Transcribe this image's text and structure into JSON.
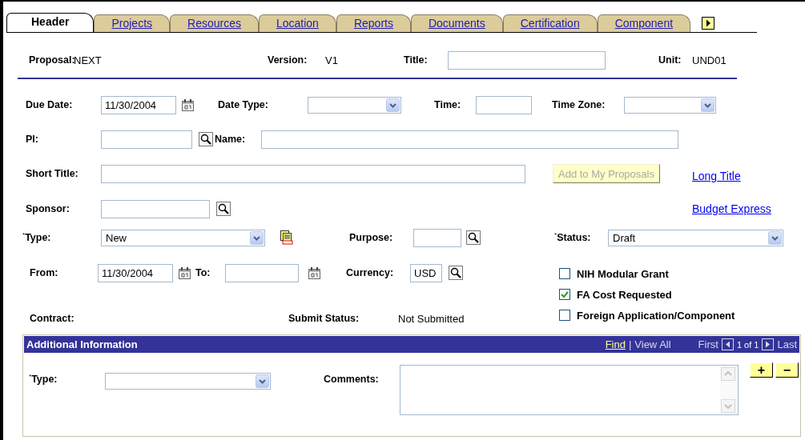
{
  "tabs": [
    {
      "label": "Header",
      "selected": true
    },
    {
      "label": "Projects",
      "selected": false
    },
    {
      "label": "Resources",
      "selected": false
    },
    {
      "label": "Location",
      "selected": false
    },
    {
      "label": "Reports",
      "selected": false
    },
    {
      "label": "Documents",
      "selected": false
    },
    {
      "label": "Certification",
      "selected": false
    },
    {
      "label": "Component",
      "selected": false
    }
  ],
  "summary": {
    "proposal": {
      "label": "Proposal:",
      "value": "NEXT"
    },
    "version": {
      "label": "Version:",
      "value": "V1"
    },
    "title": {
      "label": "Title:"
    },
    "unit": {
      "label": "Unit:",
      "value": "UND01"
    }
  },
  "due_date": {
    "label": "Due Date:",
    "value": "11/30/2004"
  },
  "date_type": {
    "label": "Date Type:"
  },
  "time": {
    "label": "Time:"
  },
  "time_zone": {
    "label": "Time Zone:"
  },
  "pi": {
    "label": "PI:"
  },
  "name": {
    "label": "Name:"
  },
  "short_title": {
    "label": "Short Title:"
  },
  "add_button": {
    "label": "Add to My Proposals",
    "disabled": true
  },
  "long_title_link": "Long Title",
  "sponsor": {
    "label": "Sponsor:"
  },
  "budget_express_link": "Budget Express",
  "type": {
    "label": "$^{*}$Type:",
    "value": "New"
  },
  "purpose": {
    "label": "Purpose:"
  },
  "status": {
    "label": "$^{*}$Status:",
    "value": "Draft"
  },
  "from": {
    "label": "From:",
    "value": "11/30/2004"
  },
  "to": {
    "label": "To:"
  },
  "currency": {
    "label": "Currency:",
    "value": "USD"
  },
  "checkboxes": [
    {
      "label": "NIH Modular Grant",
      "checked": false
    },
    {
      "label": "FA Cost Requested",
      "checked": true
    },
    {
      "label": "Foreign Application/Component",
      "checked": false
    }
  ],
  "contract": {
    "label": "Contract:"
  },
  "submit_status": {
    "label": "Submit Status:",
    "value": "Not Submitted"
  },
  "additional_info": {
    "title": "Additional Information",
    "find": "Find",
    "separator": "|",
    "view_all": "View All",
    "first": "First",
    "count": "1 of 1",
    "last": "Last",
    "type": {
      "label": "$^{*}$Type:"
    },
    "comments": {
      "label": "Comments:"
    },
    "add": "+",
    "remove": "−"
  }
}
